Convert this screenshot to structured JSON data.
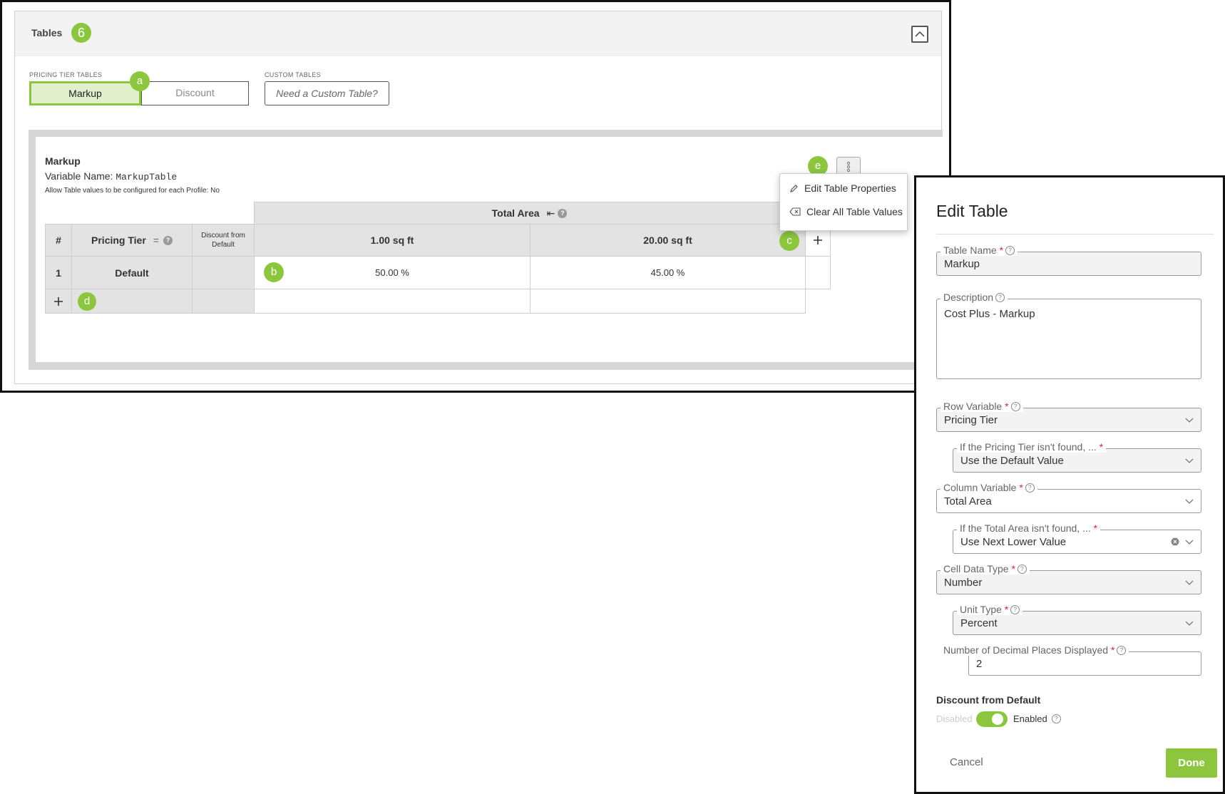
{
  "panel": {
    "title": "Tables",
    "badge": "6",
    "pricing_caption": "PRICING TIER TABLES",
    "custom_caption": "CUSTOM TABLES",
    "tabs": [
      "Markup",
      "Discount"
    ],
    "custom_button": "Need a Custom Table?"
  },
  "markers": {
    "a": "a",
    "b": "b",
    "c": "c",
    "d": "d",
    "e": "e"
  },
  "card": {
    "title": "Markup",
    "variable_label": "Variable Name: ",
    "variable_value": "MarkupTable",
    "allow_text": "Allow Table values to be configured for each Profile:  No"
  },
  "table": {
    "column_group": "Total Area",
    "col_hash": "#",
    "col_tier": "Pricing Tier",
    "col_discount": "Discount from Default",
    "area_columns": [
      "1.00  sq ft",
      "20.00  sq ft"
    ],
    "row": {
      "num": "1",
      "tier": "Default",
      "values": [
        "50.00 %",
        "45.00 %"
      ]
    }
  },
  "context_menu": [
    "Edit Table Properties",
    "Clear All Table Values"
  ],
  "dialog": {
    "title": "Edit Table",
    "table_name_label": "Table Name",
    "table_name": "Markup",
    "description_label": "Description",
    "description": "Cost Plus - Markup",
    "row_variable_label": "Row Variable",
    "row_variable": "Pricing Tier",
    "row_fallback_label": "If the Pricing Tier isn't found, ...",
    "row_fallback": "Use the Default Value",
    "column_variable_label": "Column Variable",
    "column_variable": "Total Area",
    "column_fallback_label": "If the Total Area isn't found, ...",
    "column_fallback": "Use Next Lower Value",
    "cell_type_label": "Cell Data Type",
    "cell_type": "Number",
    "unit_type_label": "Unit Type",
    "unit_type": "Percent",
    "decimals_label": "Number of Decimal Places Displayed",
    "decimals": "2",
    "discount_heading": "Discount from Default",
    "toggle_off": "Disabled",
    "toggle_on": "Enabled",
    "toggle_enabled": true,
    "cancel": "Cancel",
    "done": "Done"
  },
  "colors": {
    "accent": "#8cc63f",
    "required": "#d9262c"
  }
}
